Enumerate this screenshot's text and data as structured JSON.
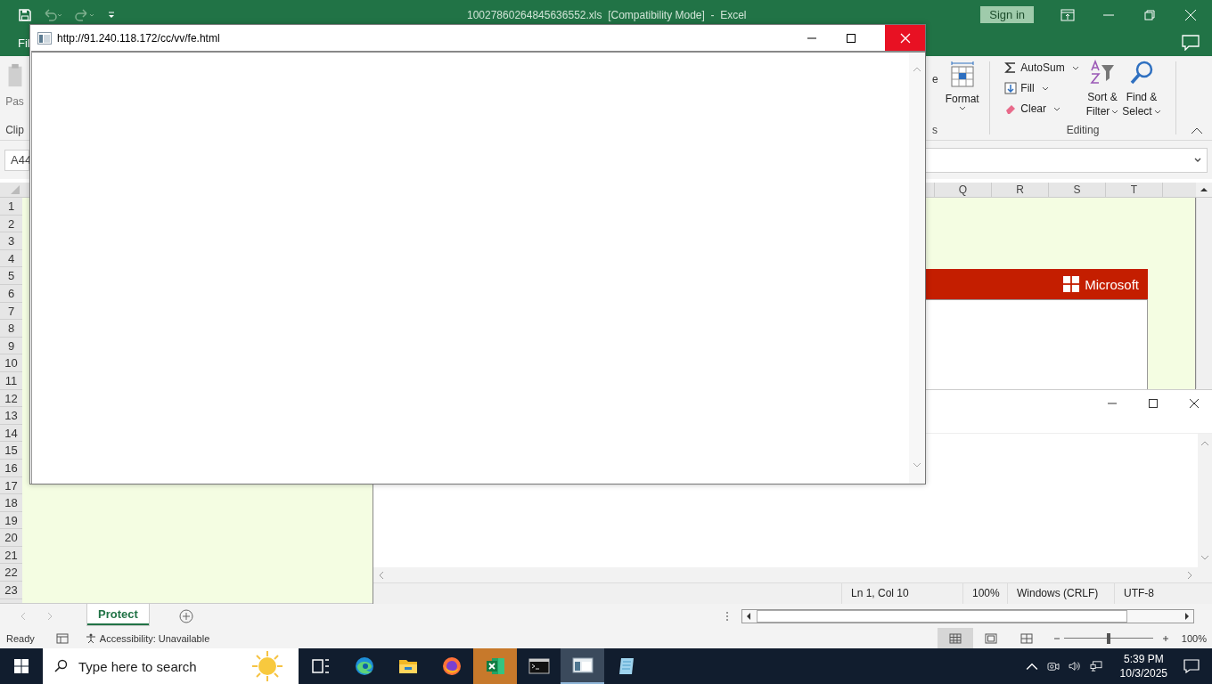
{
  "excel": {
    "title": "10027860264845636552.xls  [Compatibility Mode]  -  Excel",
    "sign_in": "Sign in",
    "ribbon_tab": "Fil",
    "clipboard": {
      "paste": "Pas",
      "group": "Clip"
    },
    "cells": {
      "button": "e",
      "format": "Format",
      "group": "s"
    },
    "editing": {
      "items": [
        {
          "kind": "autosum",
          "label": "AutoSum"
        },
        {
          "kind": "fill",
          "label": "Fill"
        },
        {
          "kind": "clear",
          "label": "Clear"
        }
      ],
      "sort": [
        "Sort &",
        "Filter"
      ],
      "find": [
        "Find &",
        "Select"
      ],
      "group": "Editing"
    },
    "name_box": "A44",
    "columns": [
      "Q",
      "R",
      "S",
      "T"
    ],
    "rows": [
      "1",
      "2",
      "3",
      "4",
      "5",
      "6",
      "7",
      "8",
      "9",
      "10",
      "11",
      "12",
      "13",
      "14",
      "15",
      "16",
      "17",
      "18",
      "19",
      "20",
      "21",
      "22",
      "23"
    ],
    "banner": {
      "logo": "Microsoft"
    },
    "sheet_tabs": [
      {
        "label": "Protect",
        "selected": true
      }
    ],
    "status": {
      "ready": "Ready",
      "accessibility": "Accessibility: Unavailable",
      "zoom": "100%",
      "level": 0.5
    },
    "views": [
      {
        "kind": "normal",
        "selected": true
      },
      {
        "kind": "page_layout",
        "selected": false
      },
      {
        "kind": "page_break",
        "selected": false
      }
    ]
  },
  "notepad": {
    "status": [
      "Ln 1, Col 10",
      "100%",
      "Windows (CRLF)",
      "UTF-8"
    ]
  },
  "popup": {
    "url": "http://91.240.118.172/cc/vv/fe.html"
  },
  "taskbar": {
    "search_placeholder": "Type here to search",
    "apps": [
      {
        "kind": "task_view",
        "selected": false,
        "flashing": false
      },
      {
        "kind": "edge",
        "selected": false,
        "flashing": false
      },
      {
        "kind": "explorer",
        "selected": false,
        "flashing": false
      },
      {
        "kind": "firefox",
        "selected": false,
        "flashing": false
      },
      {
        "kind": "excel",
        "selected": false,
        "flashing": true
      },
      {
        "kind": "terminal",
        "selected": false,
        "flashing": false
      },
      {
        "kind": "window",
        "selected": true,
        "flashing": false
      },
      {
        "kind": "notepad",
        "selected": false,
        "flashing": false
      }
    ],
    "time": "5:39 PM",
    "date": "10/3/2025"
  }
}
